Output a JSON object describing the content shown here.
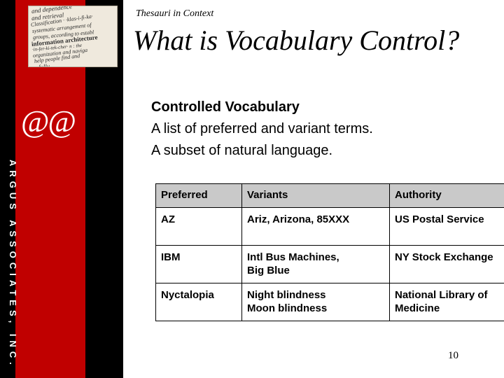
{
  "slide": {
    "kicker": "Thesauri in Context",
    "title": "What is Vocabulary Control?",
    "page_number": "10",
    "bullets": [
      {
        "text": "Controlled Vocabulary",
        "bold": true
      },
      {
        "text": "A list of preferred and variant terms.",
        "bold": false
      },
      {
        "text": "A subset of natural language.",
        "bold": false
      }
    ]
  },
  "branding": {
    "logo_text": "@@",
    "vertical_text": "ARGUS ASSOCIATES, INC.",
    "collage_lines": [
      "and dependence",
      "and retrieval",
      "Classification · ·klas-i-fi-ka·",
      "systematic arrangement of",
      "groups, according to establ",
      "information architecture",
      "·in-fer-ki-tek-cher· n : the",
      "organization and naviga",
      "help people find and",
      "fully"
    ]
  },
  "table": {
    "headers": [
      "Preferred",
      "Variants",
      "Authority"
    ],
    "rows": [
      {
        "preferred": "AZ",
        "variants": [
          "Ariz, Arizona, 85XXX"
        ],
        "authority": [
          "US Postal Service"
        ]
      },
      {
        "preferred": "IBM",
        "variants": [
          "Intl Bus Machines,",
          "Big Blue"
        ],
        "authority": [
          "NY Stock Exchange"
        ]
      },
      {
        "preferred": "Nyctalopia",
        "variants": [
          "Night blindness",
          "Moon blindness"
        ],
        "authority": [
          "National Library of Medicine"
        ]
      }
    ]
  },
  "colors": {
    "accent_red": "#c00000",
    "band_black": "#000000",
    "header_gray": "#c9c9c9"
  }
}
